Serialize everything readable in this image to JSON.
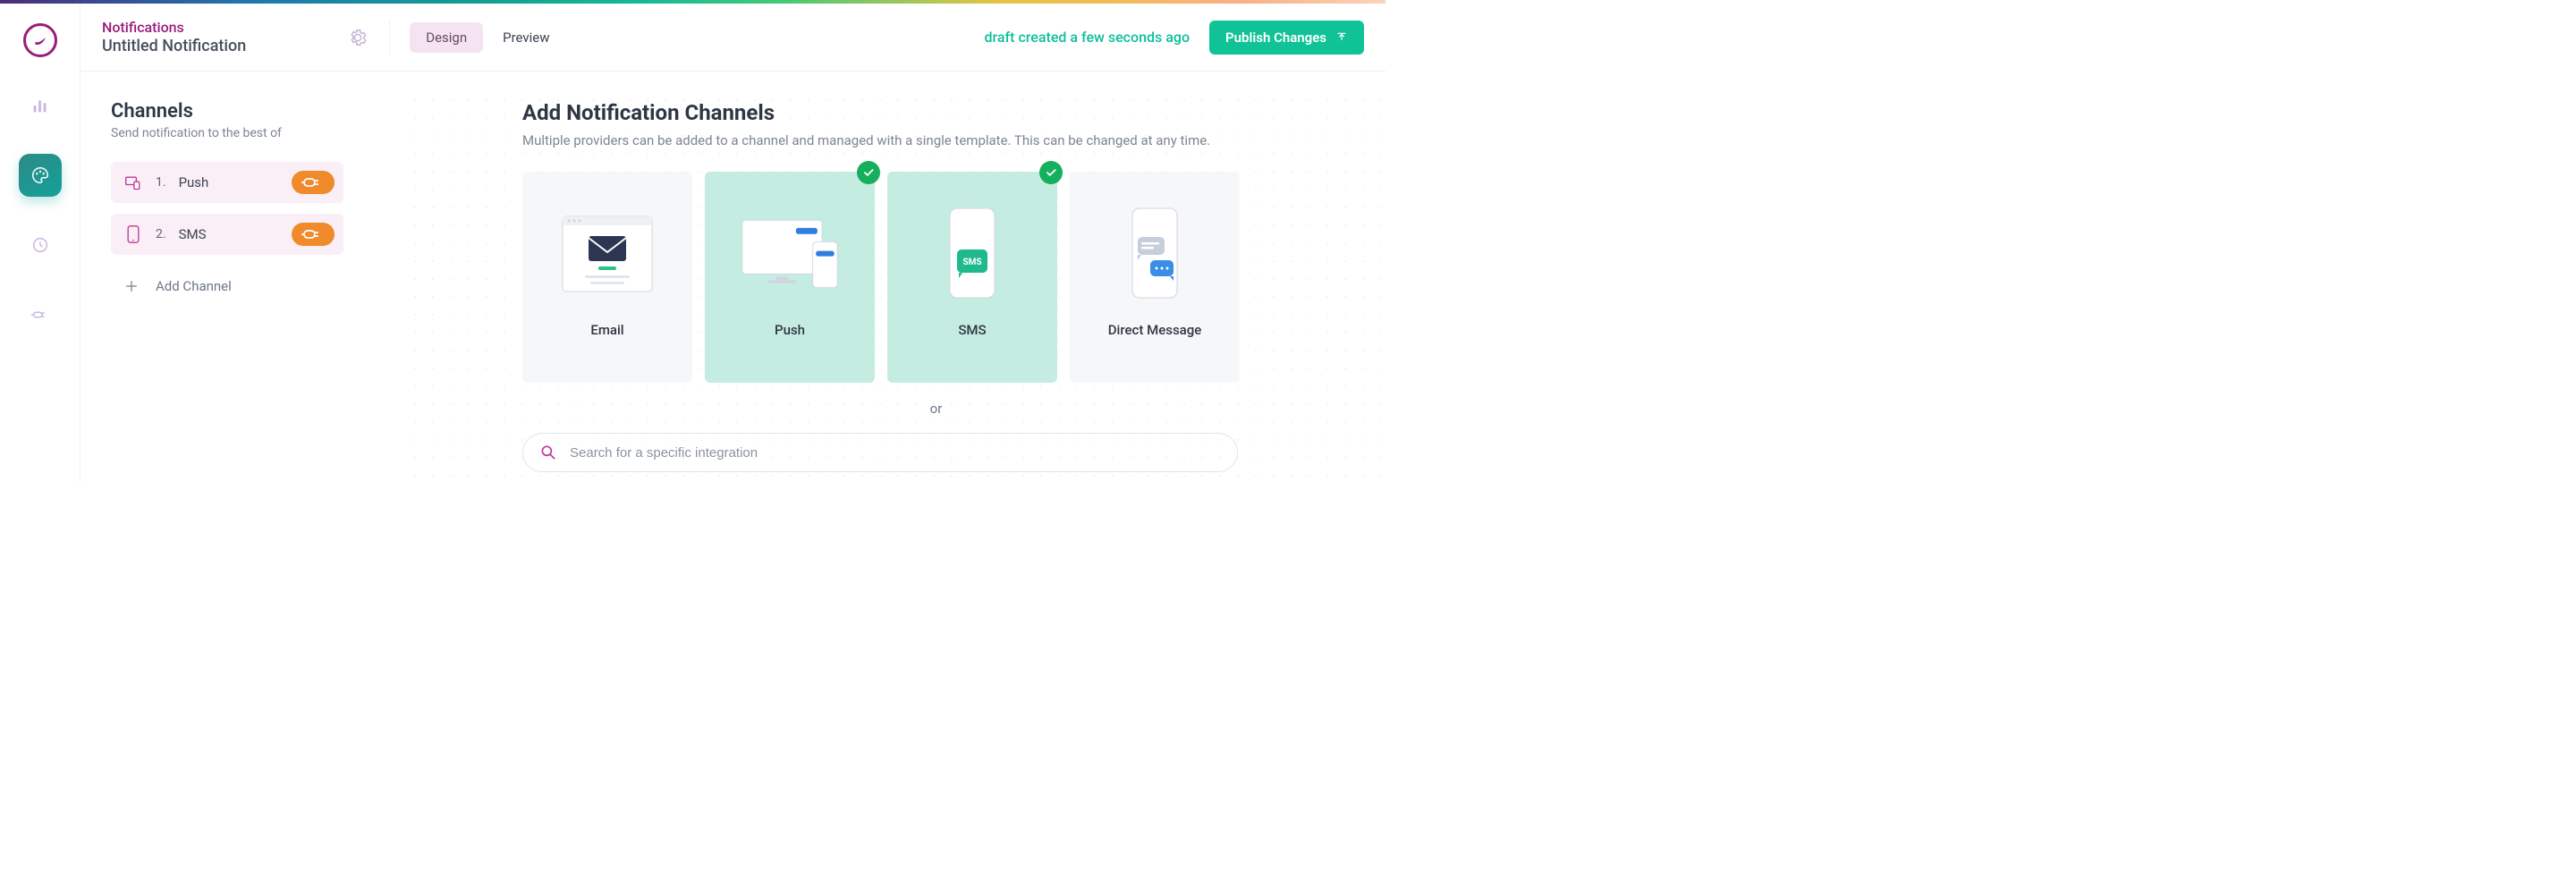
{
  "colors": {
    "brand_purple": "#9a1b7c",
    "accent_green": "#10c397",
    "pill_orange": "#f08a2a"
  },
  "header": {
    "breadcrumb": "Notifications",
    "title": "Untitled Notification",
    "design_tab": "Design",
    "preview_tab": "Preview",
    "active_tab": "Design",
    "draft_status": "draft created a few seconds ago",
    "publish_label": "Publish Changes"
  },
  "left": {
    "title": "Channels",
    "subtitle": "Send notification to the best of",
    "items": [
      {
        "index": "1.",
        "name": "Push",
        "icon": "devices"
      },
      {
        "index": "2.",
        "name": "SMS",
        "icon": "phone"
      }
    ],
    "add_label": "Add Channel"
  },
  "right": {
    "title": "Add Notification Channels",
    "subtitle": "Multiple providers can be added to a channel and managed with a single template. This can be changed at any time.",
    "cards": [
      {
        "label": "Email",
        "selected": false
      },
      {
        "label": "Push",
        "selected": true
      },
      {
        "label": "SMS",
        "selected": true
      },
      {
        "label": "Direct Message",
        "selected": false
      }
    ],
    "or_label": "or",
    "search_placeholder": "Search for a specific integration"
  }
}
